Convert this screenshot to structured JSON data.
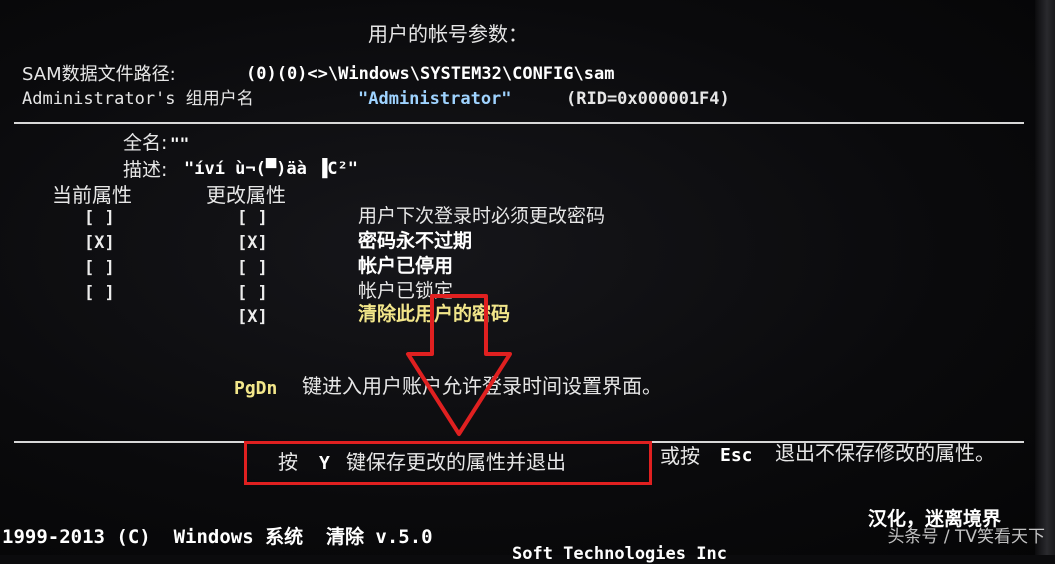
{
  "header": {
    "title": "用户的帐号参数："
  },
  "sam": {
    "path_label": "SAM数据文件路径:",
    "path_value": "(0)(0)<>\\Windows\\SYSTEM32\\CONFIG\\sam",
    "group_label": "Administrator's 组用户名",
    "group_value": "\"Administrator\"",
    "rid": "(RID=0x000001F4)"
  },
  "info": {
    "fullname_label": "全名:",
    "fullname_value": "\"\"",
    "desc_label": "描述:",
    "desc_value": "\"íví ù¬(▀)äà ▐C²\""
  },
  "columns": {
    "current": "当前属性",
    "change": "更改属性"
  },
  "attributes": [
    {
      "current": "[ ]",
      "change": "[ ]",
      "label": "用户下次登录时必须更改密码"
    },
    {
      "current": "[X]",
      "change": "[X]",
      "label": "密码永不过期"
    },
    {
      "current": "[ ]",
      "change": "[ ]",
      "label": "帐户已停用"
    },
    {
      "current": "[ ]",
      "change": "[ ]",
      "label": "帐户已锁定"
    },
    {
      "current": "",
      "change": "[X]",
      "label": "清除此用户的密码"
    }
  ],
  "pgdn": {
    "key": "PgDn",
    "text": "键进入用户账户允许登录时间设置界面。"
  },
  "save": {
    "pre": "按",
    "key": "Y",
    "text": "键保存更改的属性并退出",
    "or": "或按",
    "esc": "Esc",
    "esc_text": "退出不保存修改的属性。"
  },
  "footer": {
    "line1": "1999-2013 (C)  Windows 系统  清除 v.5.0",
    "line2": "Soft Technologies Inc",
    "localize": "汉化，迷离境界"
  },
  "watermark": "头条号 / TV笑看天下",
  "colors": {
    "highlight_box": "#e02020",
    "arrow": "#e02020",
    "yellow_text": "#f2e68a"
  }
}
